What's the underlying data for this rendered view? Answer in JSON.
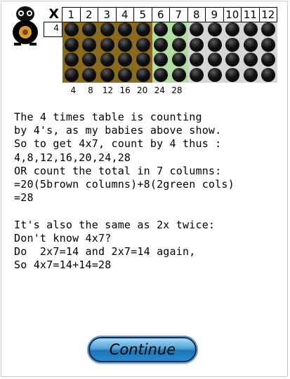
{
  "grid": {
    "corner_label": "X",
    "row_label": "4",
    "columns": [
      "1",
      "2",
      "3",
      "4",
      "5",
      "6",
      "7",
      "8",
      "9",
      "10",
      "11",
      "12"
    ],
    "rows": 4,
    "brown_columns": 5,
    "green_columns": 2,
    "colors": {
      "brown": "#8a6a1e",
      "green": "#b3dca0",
      "grey": "#d6d6d6",
      "dot": "#000000"
    }
  },
  "multiples": [
    "4",
    "8",
    "12",
    "16",
    "20",
    "24",
    "28"
  ],
  "text_lines": [
    "The 4 times table is counting",
    "by 4's, as my babies above show.",
    "So to get 4x7, count by 4 thus :",
    "4,8,12,16,20,24,28",
    "OR count the total in 7 columns:",
    "=20(5brown columns)+8(2green cols)",
    "=28",
    "",
    "It's also the same as 2x twice:",
    "Don't know 4x7?",
    "Do  2x7=14 and 2x7=14 again,",
    "So 4x7=14+14=28"
  ],
  "continue_label": "Continue"
}
